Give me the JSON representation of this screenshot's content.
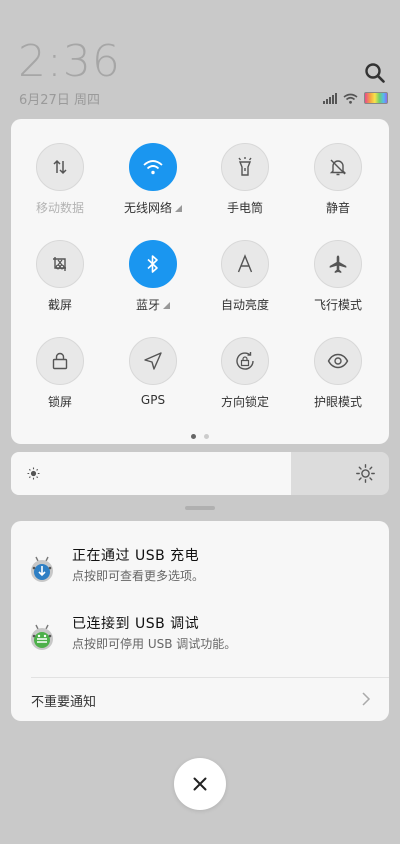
{
  "status": {
    "time": "2:36",
    "date": "6月27日 周四"
  },
  "quick_settings": {
    "tiles": [
      {
        "label": "移动数据",
        "icon": "mobile-data-icon",
        "active": false,
        "dim": true
      },
      {
        "label": "无线网络",
        "icon": "wifi-icon",
        "active": true,
        "expandable": true
      },
      {
        "label": "手电筒",
        "icon": "flashlight-icon",
        "active": false
      },
      {
        "label": "静音",
        "icon": "mute-bell-icon",
        "active": false
      },
      {
        "label": "截屏",
        "icon": "screenshot-icon",
        "active": false
      },
      {
        "label": "蓝牙",
        "icon": "bluetooth-icon",
        "active": true,
        "expandable": true
      },
      {
        "label": "自动亮度",
        "icon": "auto-brightness-icon",
        "active": false
      },
      {
        "label": "飞行模式",
        "icon": "airplane-icon",
        "active": false
      },
      {
        "label": "锁屏",
        "icon": "lock-icon",
        "active": false
      },
      {
        "label": "GPS",
        "icon": "gps-icon",
        "active": false
      },
      {
        "label": "方向锁定",
        "icon": "rotation-lock-icon",
        "active": false
      },
      {
        "label": "护眼模式",
        "icon": "eye-icon",
        "active": false
      }
    ],
    "page_count": 2,
    "current_page": 1
  },
  "brightness": {
    "level": 0.74
  },
  "notifications": [
    {
      "title": "正在通过 USB 充电",
      "subtitle": "点按即可查看更多选项。",
      "icon": "android-usb-icon"
    },
    {
      "title": "已连接到 USB 调试",
      "subtitle": "点按即可停用 USB 调试功能。",
      "icon": "android-debug-icon"
    }
  ],
  "unimportant_label": "不重要通知",
  "colors": {
    "accent": "#1a96f0"
  }
}
